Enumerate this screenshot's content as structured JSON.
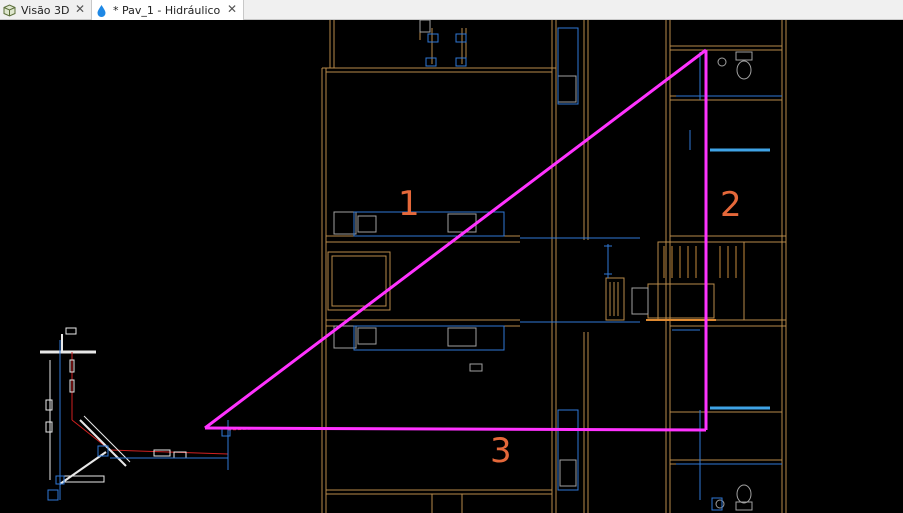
{
  "tabs": [
    {
      "label": "Visão 3D",
      "icon": "cube-icon",
      "close": "✕"
    },
    {
      "label": "* Pav_1 - Hidráulico",
      "icon": "water-drop-icon",
      "close": "✕"
    }
  ],
  "annotations": {
    "one": "1",
    "two": "2",
    "three": "3"
  },
  "colors": {
    "triangle": "#ff33ff",
    "walls": "#b88a4a",
    "pipes": "#2f78d6",
    "labels": "#e5683a",
    "canvas": "#000000"
  }
}
